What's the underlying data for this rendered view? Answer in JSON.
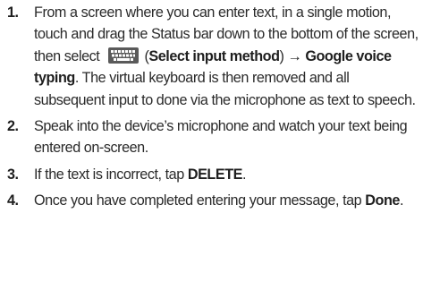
{
  "steps": [
    {
      "number": "1.",
      "part1": "From a screen where you can enter text, in a single motion, touch and drag the Status bar down to the bottom of the screen, then select ",
      "icon": "keyboard-icon",
      "part2": " (",
      "bold1": "Select input method",
      "part3": ") ",
      "bold2": "→ Google voice typing",
      "part4": ". The virtual keyboard is then removed and all subsequent input to done via the microphone as text to speech."
    },
    {
      "number": "2.",
      "text": "Speak into the device’s microphone and watch your text being entered on-screen."
    },
    {
      "number": "3.",
      "text": "If the text is incorrect, tap ",
      "bold": "DELETE",
      "end": "."
    },
    {
      "number": "4.",
      "text": "Once you have completed entering your message, tap ",
      "bold": "Done",
      "end": "."
    }
  ]
}
